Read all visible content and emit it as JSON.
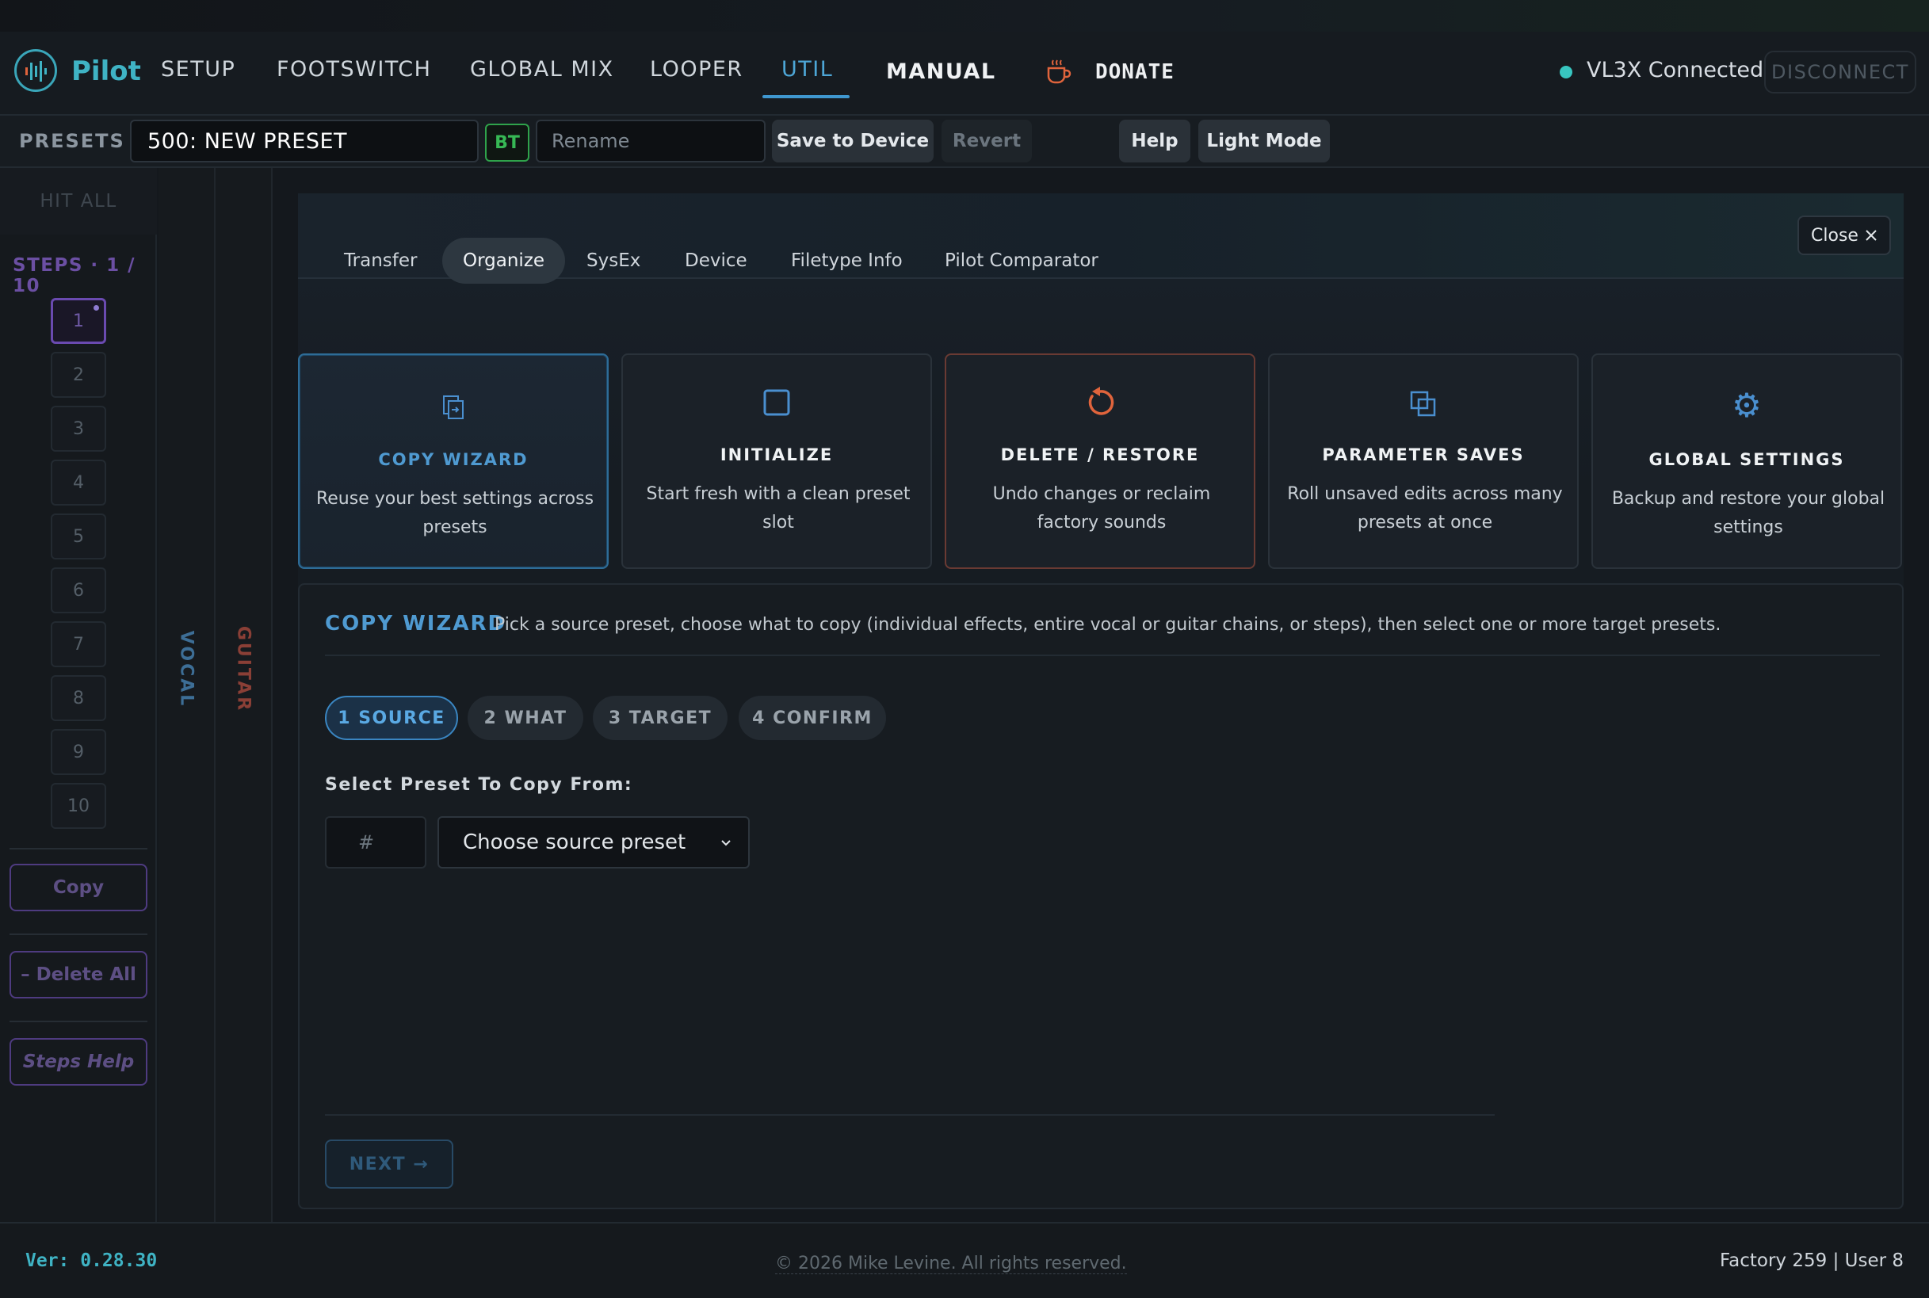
{
  "app": {
    "name": "Pilot"
  },
  "nav": {
    "items": [
      "SETUP",
      "FOOTSWITCH",
      "GLOBAL MIX",
      "LOOPER",
      "UTIL",
      "MANUAL"
    ],
    "active": "UTIL",
    "donate": "DONATE",
    "status": "VL3X Connected",
    "disconnect": "DISCONNECT"
  },
  "presets": {
    "label": "PRESETS",
    "current": "500: NEW PRESET",
    "bt": "BT",
    "rename_placeholder": "Rename",
    "save": "Save to Device",
    "revert": "Revert",
    "help": "Help",
    "light_mode": "Light Mode"
  },
  "steps": {
    "hit_all": "HIT ALL",
    "title": "STEPS · 1 / 10",
    "items": [
      "1",
      "2",
      "3",
      "4",
      "5",
      "6",
      "7",
      "8",
      "9",
      "10"
    ],
    "active": "1",
    "copy": "Copy",
    "delete_all": "– Delete All",
    "help": "Steps Help"
  },
  "columns": {
    "vocal": "VOCAL",
    "guitar": "GUITAR"
  },
  "util": {
    "tabs": [
      "Transfer",
      "Organize",
      "SysEx",
      "Device",
      "Filetype Info",
      "Pilot Comparator"
    ],
    "active_tab": "Organize",
    "close": "Close",
    "cards": [
      {
        "title": "COPY WIZARD",
        "desc": "Reuse your best settings across presets",
        "icon": "copy-icon",
        "color": "#4a8fcf"
      },
      {
        "title": "INITIALIZE",
        "desc": "Start fresh with a clean preset slot",
        "icon": "square-icon",
        "color": "#4a8fcf"
      },
      {
        "title": "DELETE / RESTORE",
        "desc": "Undo changes or reclaim factory sounds",
        "icon": "restore-icon",
        "color": "#e0643c"
      },
      {
        "title": "PARAMETER SAVES",
        "desc": "Roll unsaved edits across many presets at once",
        "icon": "layers-icon",
        "color": "#4a8fcf"
      },
      {
        "title": "GLOBAL SETTINGS",
        "desc": "Backup and restore your global settings",
        "icon": "gear-icon",
        "color": "#4a8fcf"
      }
    ]
  },
  "wizard": {
    "title": "COPY WIZARD",
    "desc": "Pick a source preset, choose what to copy (individual effects, entire vocal or guitar chains, or steps), then select one or more target presets.",
    "steps": [
      "1 SOURCE",
      "2 WHAT",
      "3 TARGET",
      "4 CONFIRM"
    ],
    "active_step": "1 SOURCE",
    "select_label": "Select Preset To Copy From:",
    "number_placeholder": "#",
    "source_placeholder": "Choose source preset",
    "next": "NEXT →"
  },
  "footer": {
    "version": "Ver: 0.28.30",
    "copyright": "© 2026 Mike Levine. All rights reserved.",
    "counts": "Factory 259 | User 8"
  }
}
